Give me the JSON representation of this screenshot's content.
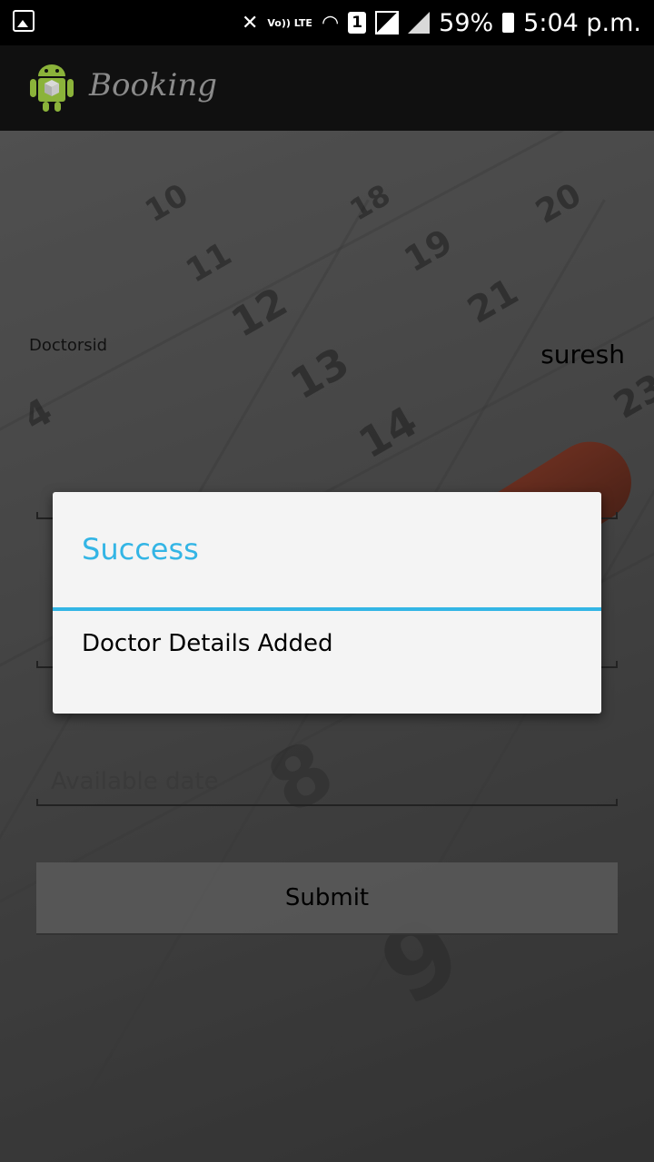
{
  "status_bar": {
    "network_label": "Vo)) LTE",
    "sim_slot": "1",
    "battery": "59%",
    "time": "5:04 p.m."
  },
  "action_bar": {
    "title": "Booking",
    "icon": "android-icon"
  },
  "form": {
    "doctor_id_label": "Doctorsid",
    "doctor_id_value": "suresh",
    "available_date_placeholder": "Available date",
    "submit_label": "Submit"
  },
  "dialog": {
    "title": "Success",
    "message": "Doctor Details Added",
    "accent_color": "#33b5e5"
  },
  "background": {
    "calendar_numbers": [
      "10",
      "11",
      "12",
      "13",
      "14",
      "18",
      "19",
      "20",
      "21",
      "4",
      "8",
      "9",
      "23"
    ]
  }
}
